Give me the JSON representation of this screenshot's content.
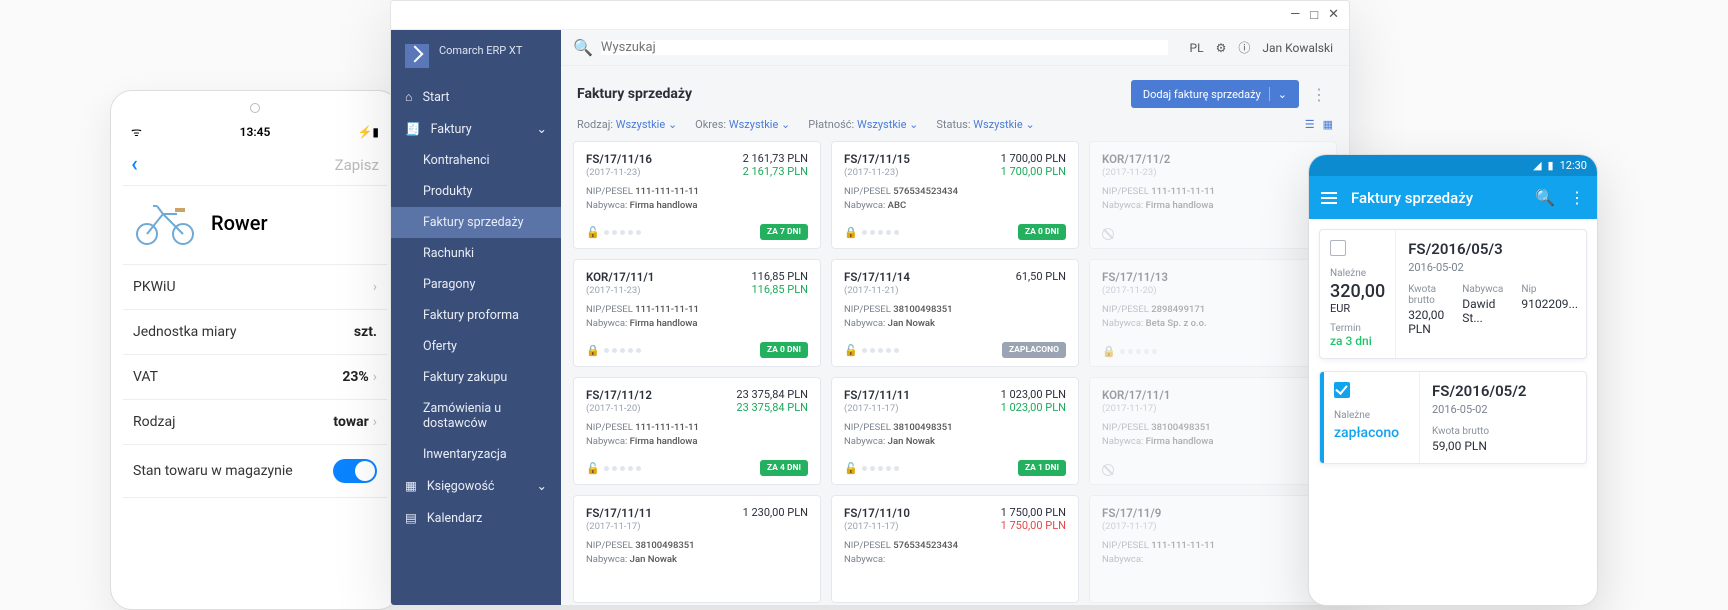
{
  "tablet": {
    "time": "13:45",
    "save": "Zapisz",
    "product_name": "Rower",
    "fields": {
      "pkwiu": "PKWiU",
      "unit_label": "Jednostka miary",
      "unit_value": "szt.",
      "vat_label": "VAT",
      "vat_value": "23%",
      "kind_label": "Rodzaj",
      "kind_value": "towar",
      "stock_label": "Stan towaru w magazynie"
    }
  },
  "desktop": {
    "window_controls": {
      "min": "—",
      "max": "□",
      "close": "✕"
    },
    "app_name": "Comarch ERP XT",
    "search_placeholder": "Wyszukaj",
    "lang": "PL",
    "user": "Jan Kowalski",
    "nav": {
      "start": "Start",
      "faktury": "Faktury",
      "kontrahenci": "Kontrahenci",
      "produkty": "Produkty",
      "faktury_sprz": "Faktury sprzedaży",
      "rachunki": "Rachunki",
      "paragony": "Paragony",
      "proforma": "Faktury proforma",
      "oferty": "Oferty",
      "zakupu": "Faktury zakupu",
      "zamowienia": "Zamówienia u dostawców",
      "inwent": "Inwentaryzacja",
      "ksiegowosc": "Księgowość",
      "kalendarz": "Kalendarz"
    },
    "page_title": "Faktury sprzedaży",
    "add_btn": "Dodaj fakturę sprzedaży",
    "filters": {
      "rodzaj_l": "Rodzaj:",
      "rodzaj_v": "Wszystkie",
      "okres_l": "Okres:",
      "okres_v": "Wszystkie",
      "platnosc_l": "Płatność:",
      "platnosc_v": "Wszystkie",
      "status_l": "Status:",
      "status_v": "Wszystkie"
    },
    "labels": {
      "nip": "NIP/PESEL",
      "nabywca": "Nabywca:"
    },
    "badges": {
      "za7": "ZA 7 DNI",
      "za0": "ZA 0 DNI",
      "za4": "ZA 4 DNI",
      "za1": "ZA 1 DNI",
      "zapl": "ZAPŁACONO"
    },
    "cards": [
      {
        "no": "FS/17/11/16",
        "date": "(2017-11-23)",
        "a1": "2 161,73 PLN",
        "a2": "2 161,73 PLN",
        "nip": "111-111-11-11",
        "buyer": "Firma handlowa",
        "badge": "za7",
        "faded": false,
        "ban": false,
        "a2c": "g",
        "lock": "open"
      },
      {
        "no": "FS/17/11/15",
        "date": "(2017-11-23)",
        "a1": "1 700,00 PLN",
        "a2": "1 700,00 PLN",
        "nip": "576534523434",
        "buyer": "ABC",
        "badge": "za0",
        "faded": false,
        "ban": false,
        "a2c": "g",
        "lock": "closed"
      },
      {
        "no": "KOR/17/11/2",
        "date": "(2017-11-23)",
        "a1": "",
        "a2": "",
        "nip": "111-111-11-11",
        "buyer": "Firma handlowa",
        "badge": "",
        "faded": true,
        "ban": true,
        "a2c": "",
        "lock": ""
      },
      {
        "no": "KOR/17/11/1",
        "date": "(2017-11-23)",
        "a1": "116,85 PLN",
        "a2": "116,85 PLN",
        "nip": "111-111-11-11",
        "buyer": "Firma handlowa",
        "badge": "za0",
        "faded": false,
        "ban": false,
        "a2c": "g",
        "lock": "closed"
      },
      {
        "no": "FS/17/11/14",
        "date": "(2017-11-21)",
        "a1": "61,50 PLN",
        "a2": "",
        "nip": "38100498351",
        "buyer": "Jan Nowak",
        "badge": "zapl",
        "faded": false,
        "ban": false,
        "a2c": "",
        "lock": "open"
      },
      {
        "no": "FS/17/11/13",
        "date": "(2017-11-20)",
        "a1": "",
        "a2": "",
        "nip": "2898499171",
        "buyer": "Beta Sp. z o.o.",
        "badge": "",
        "faded": true,
        "ban": false,
        "a2c": "",
        "lock": "closed"
      },
      {
        "no": "FS/17/11/12",
        "date": "(2017-11-20)",
        "a1": "23 375,84 PLN",
        "a2": "23 375,84 PLN",
        "nip": "111-111-11-11",
        "buyer": "Firma handlowa",
        "badge": "za4",
        "faded": false,
        "ban": false,
        "a2c": "g",
        "lock": "open"
      },
      {
        "no": "FS/17/11/11",
        "date": "(2017-11-17)",
        "a1": "1 023,00 PLN",
        "a2": "1 023,00 PLN",
        "nip": "38100498351",
        "buyer": "Jan Nowak",
        "badge": "za1",
        "faded": false,
        "ban": false,
        "a2c": "g",
        "lock": "open"
      },
      {
        "no": "KOR/17/11/1",
        "date": "(2017-11-17)",
        "a1": "",
        "a2": "",
        "nip": "38100498351",
        "buyer": "Firma handlowa",
        "badge": "",
        "faded": true,
        "ban": true,
        "a2c": "",
        "lock": ""
      },
      {
        "no": "FS/17/11/11",
        "date": "(2017-11-17)",
        "a1": "1 230,00 PLN",
        "a2": "",
        "nip": "38100498351",
        "buyer": "Jan Nowak",
        "badge": "",
        "faded": false,
        "ban": false,
        "a2c": "",
        "lock": ""
      },
      {
        "no": "FS/17/11/10",
        "date": "(2017-11-17)",
        "a1": "1 750,00 PLN",
        "a2": "1 750,00 PLN",
        "nip": "576534523434",
        "buyer": "",
        "badge": "",
        "faded": false,
        "ban": false,
        "a2c": "r",
        "lock": ""
      },
      {
        "no": "FS/17/11/9",
        "date": "(2017-11-17)",
        "a1": "",
        "a2": "",
        "nip": "111-111-11-11",
        "buyer": "",
        "badge": "",
        "faded": true,
        "ban": false,
        "a2c": "",
        "lock": ""
      }
    ]
  },
  "phone": {
    "time": "12:30",
    "title": "Faktury sprzedaży",
    "cards": [
      {
        "checked": false,
        "stripe": "g",
        "nalezne_l": "Należne",
        "amount": "320,00",
        "cur": "EUR",
        "termin_l": "Termin",
        "termin_v": "za 3 dni",
        "doc": "FS/2016/05/3",
        "date": "2016-05-02",
        "kwota_l": "Kwota brutto",
        "kwota_v": "320,00 PLN",
        "nabywca_l": "Nabywca",
        "nabywca_v": "Dawid St...",
        "nip_l": "Nip",
        "nip_v": "9102209..."
      },
      {
        "checked": true,
        "stripe": "b",
        "nalezne_l": "Należne",
        "paid": "zapłacono",
        "doc": "FS/2016/05/2",
        "date": "2016-05-02",
        "kwota_l": "Kwota brutto",
        "kwota_v": "59,00 PLN"
      }
    ]
  }
}
